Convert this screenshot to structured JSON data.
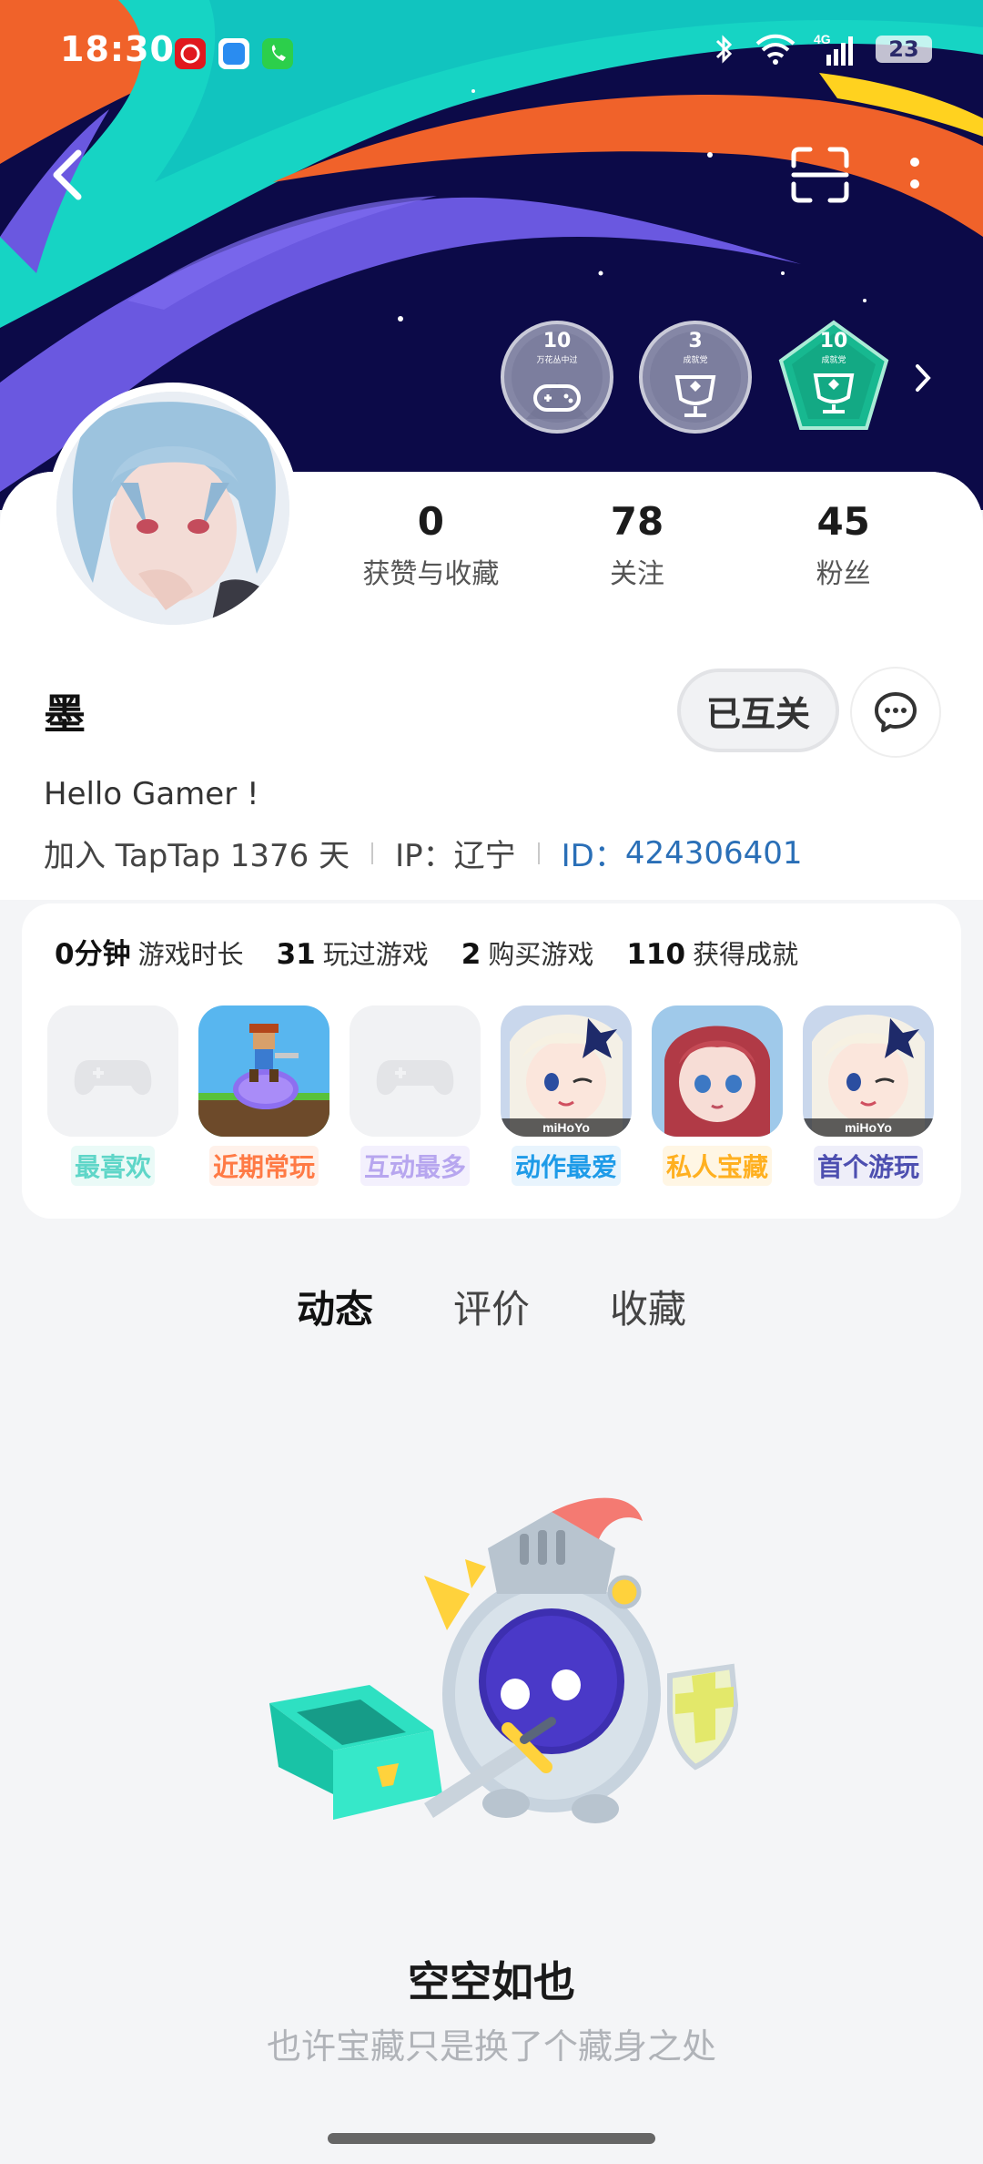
{
  "status_bar": {
    "time": "18:30",
    "battery": "23",
    "network": "4G"
  },
  "header": {
    "back_icon": "chevron-left-icon",
    "scan_icon": "scan-icon",
    "more_icon": "more-vertical-icon",
    "badges": [
      {
        "count": "10",
        "caption": "万花丛中过",
        "icon": "gamepad-icon",
        "color": "#7c7e9e"
      },
      {
        "count": "3",
        "caption": "成就党",
        "icon": "trophy-icon",
        "color": "#7c7e9e"
      },
      {
        "count": "10",
        "caption": "成就党",
        "icon": "trophy-icon",
        "color": "#12b886"
      }
    ]
  },
  "profile": {
    "stats": [
      {
        "value": "0",
        "label": "获赞与收藏"
      },
      {
        "value": "78",
        "label": "关注"
      },
      {
        "value": "45",
        "label": "粉丝"
      }
    ],
    "username": "墨",
    "mutual_button": "已互关",
    "bio": "Hello Gamer !",
    "joined": "加入 TapTap 1376 天",
    "ip": "IP：辽宁",
    "id_label": "ID：",
    "id_value": "424306401"
  },
  "game_stats": {
    "playtime_value": "0分钟",
    "playtime_label": "游戏时长",
    "played_value": "31",
    "played_label": "玩过游戏",
    "bought_value": "2",
    "bought_label": "购买游戏",
    "achievements_value": "110",
    "achievements_label": "获得成就",
    "items": [
      {
        "label": "最喜欢",
        "color": "#5fd6c8",
        "bg": "#eafaf7"
      },
      {
        "label": "近期常玩",
        "color": "#ff7a45",
        "bg": "#fff1ea"
      },
      {
        "label": "互动最多",
        "color": "#b7a6ef",
        "bg": "#f3f0fd"
      },
      {
        "label": "动作最爱",
        "color": "#1e9be8",
        "bg": "#e8f4fd"
      },
      {
        "label": "私人宝藏",
        "color": "#ffb020",
        "bg": "#fff6e4"
      },
      {
        "label": "首个游玩",
        "color": "#4d4fb0",
        "bg": "#eeeef9"
      }
    ]
  },
  "tabs": [
    "动态",
    "评价",
    "收藏"
  ],
  "empty_state": {
    "title": "空空如也",
    "subtitle": "也许宝藏只是换了个藏身之处"
  },
  "colors": {
    "accent": "#15c5ce",
    "link": "#2a6fb7",
    "banner": "#0d0b4a"
  }
}
